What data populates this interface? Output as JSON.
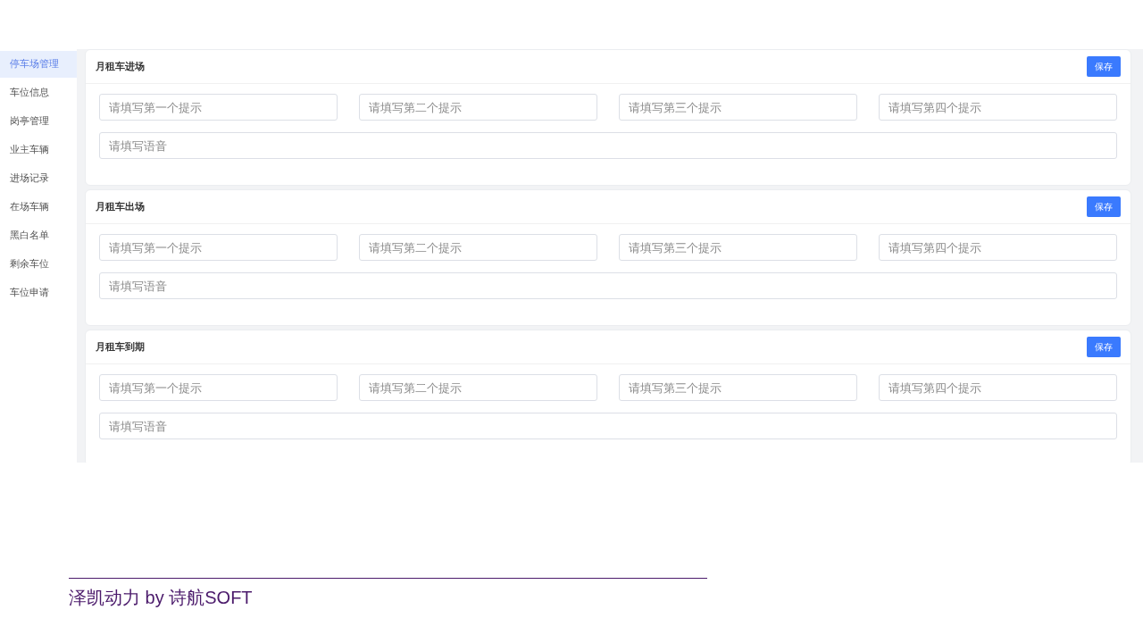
{
  "sidebar": {
    "items": [
      {
        "label": "停车场管理",
        "selected": true
      },
      {
        "label": "车位信息",
        "selected": false
      },
      {
        "label": "岗亭管理",
        "selected": false
      },
      {
        "label": "业主车辆",
        "selected": false
      },
      {
        "label": "进场记录",
        "selected": false
      },
      {
        "label": "在场车辆",
        "selected": false
      },
      {
        "label": "黑白名单",
        "selected": false
      },
      {
        "label": "剩余车位",
        "selected": false
      },
      {
        "label": "车位申请",
        "selected": false
      }
    ]
  },
  "cards": [
    {
      "title": "月租车进场",
      "button": "保存",
      "hints": [
        {
          "placeholder": "请填写第一个提示"
        },
        {
          "placeholder": "请填写第二个提示"
        },
        {
          "placeholder": "请填写第三个提示"
        },
        {
          "placeholder": "请填写第四个提示"
        }
      ],
      "voice": {
        "placeholder": "请填写语音"
      }
    },
    {
      "title": "月租车出场",
      "button": "保存",
      "hints": [
        {
          "placeholder": "请填写第一个提示"
        },
        {
          "placeholder": "请填写第二个提示"
        },
        {
          "placeholder": "请填写第三个提示"
        },
        {
          "placeholder": "请填写第四个提示"
        }
      ],
      "voice": {
        "placeholder": "请填写语音"
      }
    },
    {
      "title": "月租车到期",
      "button": "保存",
      "hints": [
        {
          "placeholder": "请填写第一个提示"
        },
        {
          "placeholder": "请填写第二个提示"
        },
        {
          "placeholder": "请填写第三个提示"
        },
        {
          "placeholder": "请填写第四个提示"
        }
      ],
      "voice": {
        "placeholder": "请填写语音"
      }
    }
  ],
  "footer": {
    "text": "泽凯动力 by 诗航SOFT"
  }
}
